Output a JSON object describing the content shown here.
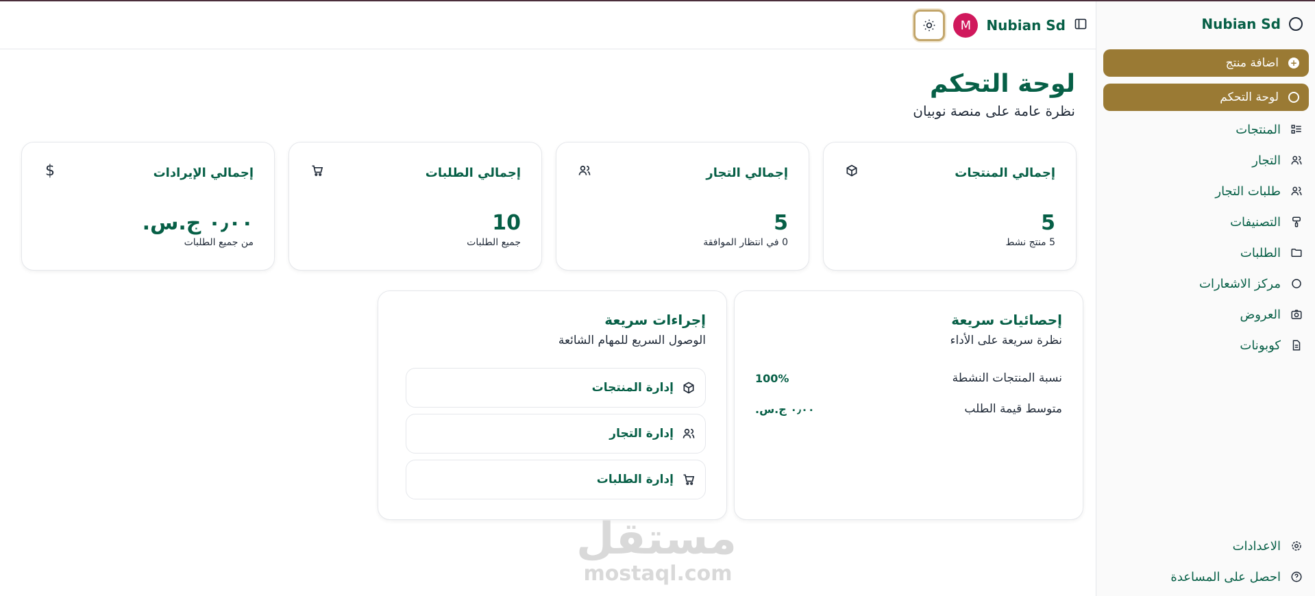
{
  "sidebar": {
    "brand": "Nubian Sd",
    "primary_buttons": [
      {
        "label": "اضافة منتج",
        "icon": "plus-circle-icon"
      },
      {
        "label": "لوحة التحكم",
        "icon": "gauge-icon"
      }
    ],
    "items": [
      {
        "label": "المنتجات",
        "icon": "list-icon"
      },
      {
        "label": "التجار",
        "icon": "users-icon"
      },
      {
        "label": "طلبات التجار",
        "icon": "users-icon"
      },
      {
        "label": "التصنيفات",
        "icon": "brush-icon"
      },
      {
        "label": "الطلبات",
        "icon": "folder-icon"
      },
      {
        "label": "مركز الاشعارات",
        "icon": "circle-icon"
      },
      {
        "label": "العروض",
        "icon": "camera-icon"
      },
      {
        "label": "كوبونات",
        "icon": "document-icon"
      }
    ],
    "footer": [
      {
        "label": "الاعدادات",
        "icon": "gear-icon"
      },
      {
        "label": "احصل على المساعدة",
        "icon": "help-icon"
      }
    ]
  },
  "header": {
    "user_name": "Nubian Sd",
    "avatar_initial": "M"
  },
  "page": {
    "title": "لوحة التحكم",
    "subtitle": "نظرة عامة على منصة نوبيان"
  },
  "stats": [
    {
      "title": "إجمالي المنتجات",
      "value": "5",
      "note": "5 منتج نشط",
      "icon": "box-icon"
    },
    {
      "title": "إجمالي التجار",
      "value": "5",
      "note": "0 في انتظار الموافقة",
      "icon": "users-icon"
    },
    {
      "title": "إجمالي الطلبات",
      "value": "10",
      "note": "جميع الطلبات",
      "icon": "cart-icon"
    },
    {
      "title": "إجمالي الإيرادات",
      "value": "٠٫٠٠ ج.س.",
      "note": "من جميع الطلبات",
      "icon": "dollar-icon",
      "icon_glyph": "$"
    }
  ],
  "quick_stats": {
    "title": "إحصائيات سريعة",
    "subtitle": "نظرة سريعة على الأداء",
    "rows": [
      {
        "label": "نسبة المنتجات النشطة",
        "value": "100%"
      },
      {
        "label": "متوسط قيمة الطلب",
        "value": "٠٫٠٠ ج.س."
      }
    ]
  },
  "quick_actions": {
    "title": "إجراءات سريعة",
    "subtitle": "الوصول السريع للمهام الشائعة",
    "buttons": [
      {
        "label": "إدارة المنتجات",
        "icon": "box-icon"
      },
      {
        "label": "إدارة التجار",
        "icon": "users-icon"
      },
      {
        "label": "إدارة الطلبات",
        "icon": "cart-icon"
      }
    ]
  },
  "watermark": {
    "arabic": "مستقل",
    "latin": "mostaql.com"
  },
  "colors": {
    "accent": "#9a7a34",
    "brand_text": "#065f46",
    "avatar": "#d0185c"
  }
}
